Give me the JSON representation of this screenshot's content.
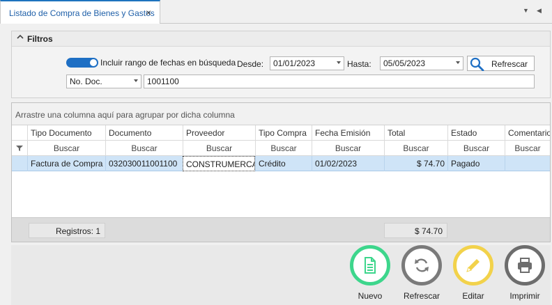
{
  "tab": {
    "title": "Listado de Compra de Bienes y Gastos",
    "close": "×"
  },
  "tab_controls": {
    "dropdown": "▼",
    "scroll_left": "◀"
  },
  "filters": {
    "title": "Filtros",
    "toggle_label": "Incluir rango de fechas en búsqueda",
    "toggle_on": true,
    "desde_label": "Desde:",
    "desde_value": "01/01/2023",
    "hasta_label": "Hasta:",
    "hasta_value": "05/05/2023",
    "refresh_label": "Refrescar",
    "doc_type_value": "No. Doc.",
    "search_value": "1001100"
  },
  "grid": {
    "group_panel_text": "Arrastre una columna aquí para agrupar por dicha columna",
    "columns": [
      "Tipo Documento",
      "Documento",
      "Proveedor",
      "Tipo Compra",
      "Fecha Emisión",
      "Total",
      "Estado",
      "Comentario"
    ],
    "search_placeholder": "Buscar",
    "rows": [
      {
        "tipo_documento": "Factura de Compra",
        "documento": "032030011001100",
        "proveedor": "CONSTRUMERCA...",
        "tipo_compra": "Crédito",
        "fecha_emision": "01/02/2023",
        "total": "$ 74.70",
        "estado": "Pagado",
        "comentario": ""
      }
    ],
    "footer": {
      "registros": "Registros: 1",
      "total_sum": "$ 74.70"
    }
  },
  "actions": [
    {
      "label": "Nuevo",
      "icon": "document-icon",
      "color": "#3dd68c"
    },
    {
      "label": "Refrescar",
      "icon": "refresh-icon",
      "color": "#7a7a7a"
    },
    {
      "label": "Editar",
      "icon": "pencil-icon",
      "color": "#f2d24b"
    },
    {
      "label": "Imprimir",
      "icon": "printer-icon",
      "color": "#6d6d6d"
    }
  ],
  "colors": {
    "accent": "#1e6fc4",
    "selected_row": "#cfe4f7"
  }
}
